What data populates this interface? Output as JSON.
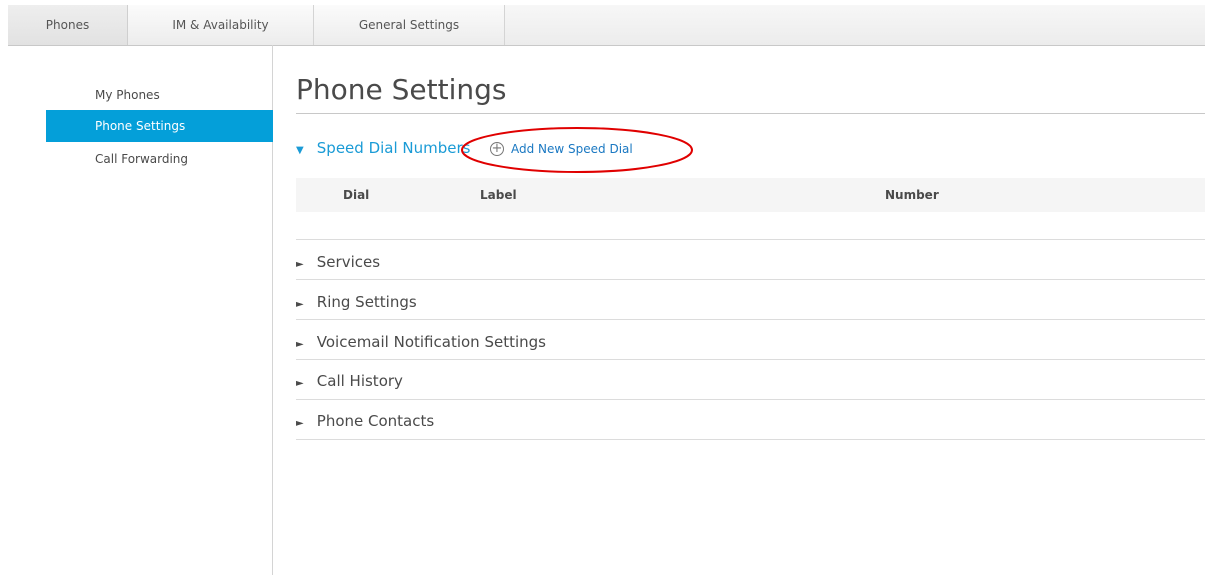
{
  "tabs": [
    {
      "label": "Phones",
      "active": true
    },
    {
      "label": "IM & Availability",
      "active": false
    },
    {
      "label": "General Settings",
      "active": false
    }
  ],
  "sidebar": {
    "items": [
      {
        "label": "My Phones",
        "active": false
      },
      {
        "label": "Phone Settings",
        "active": true
      },
      {
        "label": "Call Forwarding",
        "active": false
      }
    ]
  },
  "main": {
    "title": "Phone Settings",
    "speed_dial": {
      "heading": "Speed Dial Numbers",
      "expanded": true,
      "add_label": "Add New Speed Dial",
      "add_icon": "plus-circle-icon",
      "columns": [
        "Dial",
        "Label",
        "Number"
      ],
      "rows": []
    },
    "sections": [
      {
        "label": "Services",
        "expanded": false
      },
      {
        "label": "Ring Settings",
        "expanded": false
      },
      {
        "label": "Voicemail Notification Settings",
        "expanded": false
      },
      {
        "label": "Call History",
        "expanded": false
      },
      {
        "label": "Phone Contacts",
        "expanded": false
      }
    ]
  },
  "colors": {
    "accent": "#049fd9",
    "link": "#1a78c2",
    "annotation": "#e00000"
  }
}
